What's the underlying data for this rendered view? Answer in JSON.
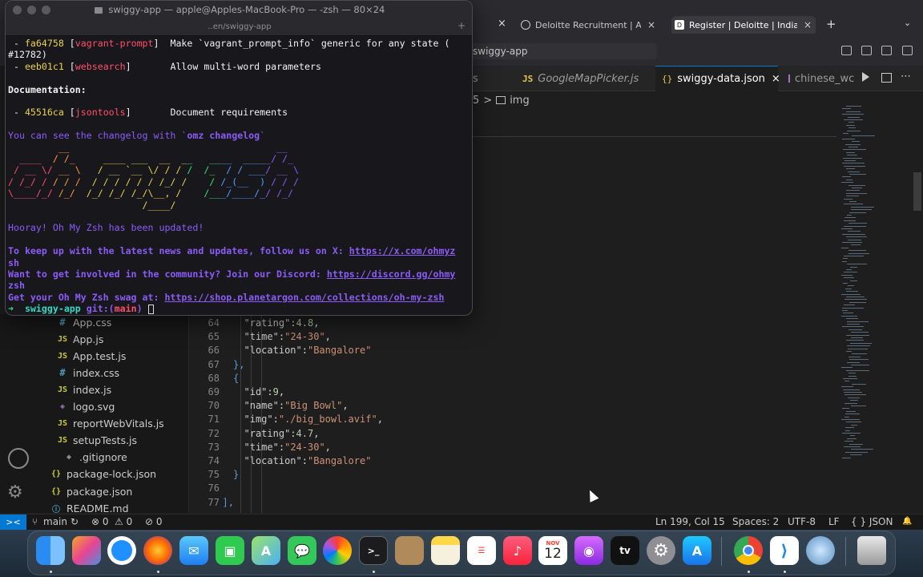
{
  "browser": {
    "tab_left_close": "×",
    "tabs": [
      {
        "label": "Deloitte Recruitment | Assoc",
        "close": "×"
      },
      {
        "label": "Register | Deloitte | India Offic",
        "close": "×"
      }
    ],
    "new_tab": "+",
    "tab_list": "⌄"
  },
  "vscode": {
    "command_center": "swiggy-app",
    "editor_tabs": [
      {
        "label": "s"
      },
      {
        "badge": "JS",
        "label": "GoogleMapPicker.js"
      },
      {
        "badge": "{}",
        "label": "swiggy-data.json",
        "close": "×"
      },
      {
        "label": "chinese_wc"
      }
    ],
    "breadcrumb": {
      "prefix": "5",
      "sep": ">",
      "item": "img"
    },
    "explorer_files": [
      {
        "icon": "#",
        "name": "App.css",
        "type": "css"
      },
      {
        "icon": "JS",
        "name": "App.js",
        "type": "js"
      },
      {
        "icon": "JS",
        "name": "App.test.js",
        "type": "js"
      },
      {
        "icon": "#",
        "name": "index.css",
        "type": "css"
      },
      {
        "icon": "JS",
        "name": "index.js",
        "type": "js"
      },
      {
        "icon": "◈",
        "name": "logo.svg",
        "type": "svg"
      },
      {
        "icon": "JS",
        "name": "reportWebVitals.js",
        "type": "js"
      },
      {
        "icon": "JS",
        "name": "setupTests.js",
        "type": "js"
      },
      {
        "icon": "◆",
        "name": ".gitignore",
        "type": "git"
      },
      {
        "icon": "{}",
        "name": "package-lock.json",
        "type": "json"
      },
      {
        "icon": "{}",
        "name": "package.json",
        "type": "json"
      },
      {
        "icon": "ⓘ",
        "name": "README.md",
        "type": "md"
      }
    ],
    "code_lines": [
      {
        "no": "64",
        "indent": 3,
        "key": "\"rating\"",
        "value": "4.8",
        "vtype": "n",
        "trail": ","
      },
      {
        "no": "65",
        "indent": 3,
        "key": "\"time\"",
        "value": "\"24-30\"",
        "vtype": "s",
        "trail": ","
      },
      {
        "no": "66",
        "indent": 3,
        "key": "\"location\"",
        "value": "\"Bangalore\"",
        "vtype": "s",
        "trail": ""
      },
      {
        "no": "67",
        "indent": 2,
        "raw": "},"
      },
      {
        "no": "68",
        "indent": 2,
        "raw": "{"
      },
      {
        "no": "69",
        "indent": 3,
        "key": "\"id\"",
        "value": "9",
        "vtype": "n",
        "trail": ","
      },
      {
        "no": "70",
        "indent": 3,
        "key": "\"name\"",
        "value": "\"Big Bowl\"",
        "vtype": "s",
        "trail": ","
      },
      {
        "no": "71",
        "indent": 3,
        "key": "\"img\"",
        "value": "\"./big_bowl.avif\"",
        "vtype": "s",
        "trail": ","
      },
      {
        "no": "72",
        "indent": 3,
        "key": "\"rating\"",
        "value": "4.7",
        "vtype": "n",
        "trail": ","
      },
      {
        "no": "73",
        "indent": 3,
        "key": "\"time\"",
        "value": "\"24-30\"",
        "vtype": "s",
        "trail": ","
      },
      {
        "no": "74",
        "indent": 3,
        "key": "\"location\"",
        "value": "\"Bangalore\"",
        "vtype": "s",
        "trail": ""
      },
      {
        "no": "75",
        "indent": 2,
        "raw": "}"
      },
      {
        "no": "76",
        "indent": 0,
        "raw": ""
      },
      {
        "no": "77",
        "indent": 1,
        "raw": "],"
      }
    ],
    "status": {
      "remote": "><",
      "branch": "main",
      "sync": "↻",
      "errors": "⊗ 0",
      "warnings": "⚠ 0",
      "ports": "⊘ 0",
      "position": "Ln 199, Col 15",
      "spaces": "Spaces: 2",
      "encoding": "UTF-8",
      "eol": "LF",
      "language": "{ } JSON",
      "bell": "🔔"
    }
  },
  "terminal": {
    "title": "swiggy-app — apple@Apples-MacBook-Pro — -zsh — 80×24",
    "tab_path": "..en/swiggy-app",
    "lines": [
      {
        "a": " - ",
        "hash": "fa64758",
        "scope": "vagrant-prompt",
        "msg": "  Make `vagrant_prompt_info` generic for any state ("
      },
      {
        "plain": "#12782)"
      },
      {
        "a": " - ",
        "hash": "eeb01c1",
        "scope": "websearch",
        "msg": "       Allow multi-word parameters"
      },
      {
        "plain": ""
      },
      {
        "heading": "Documentation:"
      },
      {
        "plain": ""
      },
      {
        "a": " - ",
        "hash": "45516ca",
        "scope": "jsontools",
        "msg": "       Document requirements"
      },
      {
        "plain": ""
      },
      {
        "purple": "You can see the changelog with `",
        "purple_bold": "omz changelog",
        "purple_end": "`"
      }
    ],
    "ascii_lines": [
      "         __                                     __   ",
      "  ____  / /_     ____ ___  __  __   ____  _____/ /_  ",
      " / __ \\/ __ \\   / __ `__ \\/ / / /  /_  / / ___/ __ \\ ",
      "/ /_/ / / / /  / / / / / / /_/ /    / /_(__  ) / / / ",
      "\\____/_/ /_/  /_/ /_/ /_/\\__, /    /___/____/_/ /_/  ",
      "                        /____/                       "
    ],
    "hooray": "Hooray! Oh My Zsh has been updated!",
    "follow_text": "To keep up with the latest news and updates, follow us on X: ",
    "follow_link": "https://x.com/ohmyz",
    "follow_link_2": "sh",
    "discord_text": "Want to get involved in the community? Join our Discord: ",
    "discord_link": "https://discord.gg/ohmy",
    "discord_link_2": "zsh",
    "swag_text": "Get your Oh My Zsh swag at: ",
    "swag_link": "https://shop.planetargon.com/collections/oh-my-zsh",
    "prompt_arrow": "➜",
    "prompt_dir": "swiggy-app",
    "prompt_git": "git:(",
    "prompt_branch": "main",
    "prompt_git_end": ")"
  },
  "dock": {
    "calendar_month": "NOV",
    "calendar_day": "12",
    "tv_label": "tv"
  }
}
